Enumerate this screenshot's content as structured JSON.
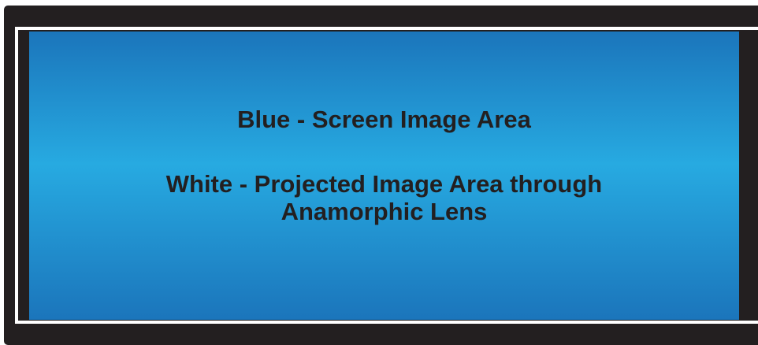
{
  "labels": {
    "blue": "Blue - Screen Image Area",
    "white_line1": "White - Projected Image Area through",
    "white_line2": "Anamorphic Lens"
  },
  "colors": {
    "frame": "#231f20",
    "projected_border": "#ffffff",
    "screen_gradient_edge": "#1b75bb",
    "screen_gradient_center": "#27aae1",
    "text": "#231f20"
  }
}
